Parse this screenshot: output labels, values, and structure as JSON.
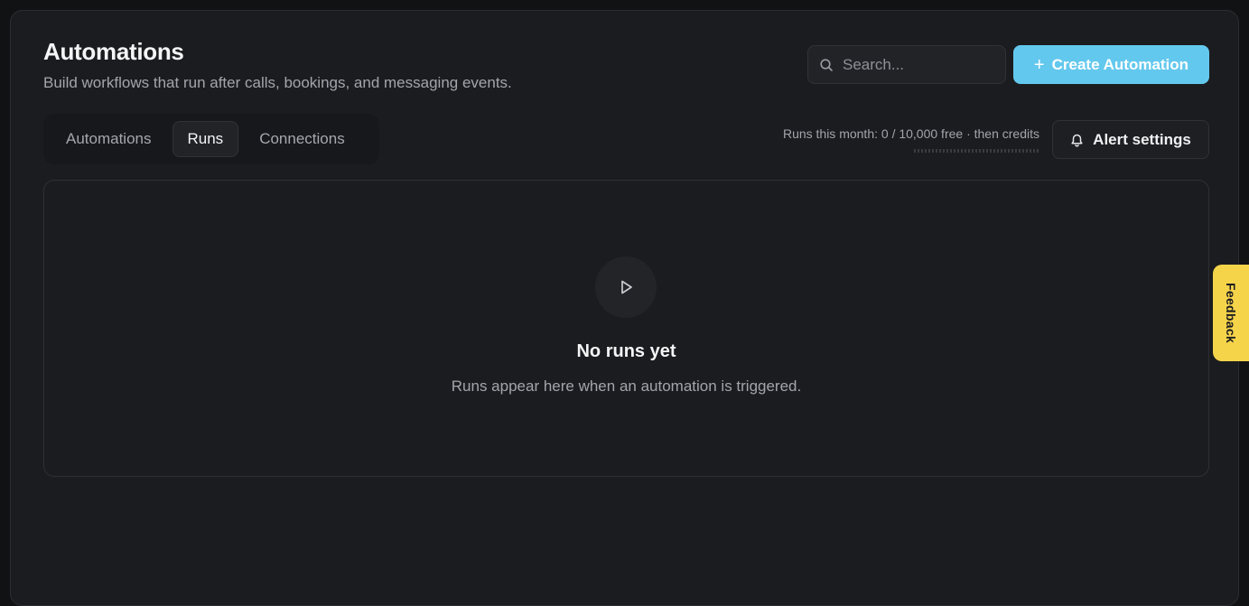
{
  "header": {
    "title": "Automations",
    "subtitle": "Build workflows that run after calls, bookings, and messaging events."
  },
  "search": {
    "placeholder": "Search...",
    "value": "",
    "icon": "search-icon"
  },
  "create_button": {
    "label": "Create Automation",
    "icon": "plus-icon"
  },
  "tabs": [
    {
      "label": "Automations",
      "active": false
    },
    {
      "label": "Runs",
      "active": true
    },
    {
      "label": "Connections",
      "active": false
    }
  ],
  "usage": {
    "text": "Runs this month: 0 / 10,000 free · then credits",
    "used": 0,
    "limit": 10000
  },
  "alert_button": {
    "label": "Alert settings",
    "icon": "bell-icon"
  },
  "empty_state": {
    "icon": "play-icon",
    "title": "No runs yet",
    "description": "Runs appear here when an automation is triggered."
  },
  "feedback": {
    "label": "Feedback"
  },
  "colors": {
    "accent": "#63c8ee",
    "feedback": "#f6d44a",
    "background": "#1b1c1f"
  }
}
